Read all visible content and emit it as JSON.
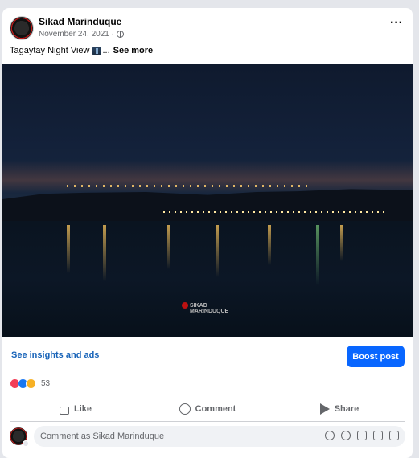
{
  "post": {
    "author": "Sikad Marinduque",
    "date": "November 24, 2021 ·",
    "caption_text": "Tagaytay Night View",
    "caption_ellipsis": "...",
    "see_more": "See more",
    "more_options": "···",
    "photo_watermark_line1": "SIKAD",
    "photo_watermark_line2": "MARINDUQUE"
  },
  "insights": {
    "link_label": "See insights and ads",
    "boost_label": "Boost post"
  },
  "reactions": {
    "types": [
      "love",
      "like",
      "wow"
    ],
    "count": "53"
  },
  "actions": {
    "like_label": "Like",
    "comment_label": "Comment",
    "share_label": "Share"
  },
  "comment": {
    "placeholder": "Comment as Sikad Marinduque",
    "icons": [
      "avatar-sticker-icon",
      "emoji-icon",
      "camera-icon",
      "gif-icon",
      "sticker-icon"
    ]
  },
  "colors": {
    "brand_blue": "#0866ff",
    "link_blue": "#1763b8",
    "muted_text": "#65676b"
  }
}
